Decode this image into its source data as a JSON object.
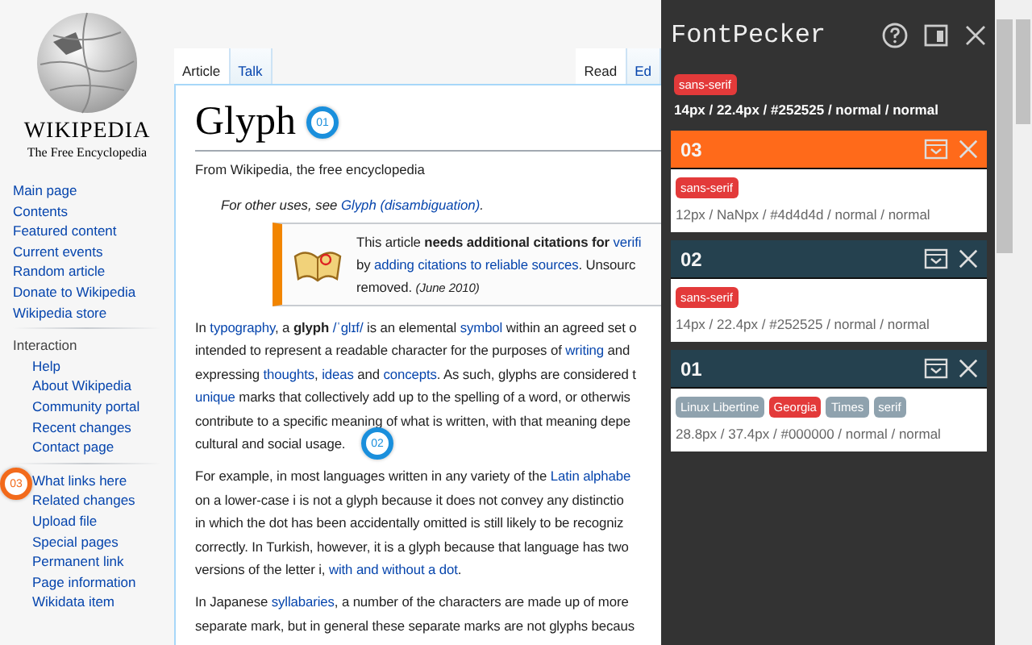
{
  "sidebar": {
    "logo": {
      "wordmark": "WIKIPEDIA",
      "tagline": "The Free Encyclopedia"
    },
    "navigation": [
      "Main page",
      "Contents",
      "Featured content",
      "Current events",
      "Random article",
      "Donate to Wikipedia",
      "Wikipedia store"
    ],
    "interaction": {
      "heading": "Interaction",
      "items": [
        "Help",
        "About Wikipedia",
        "Community portal",
        "Recent changes",
        "Contact page"
      ]
    },
    "tools": {
      "items": [
        "What links here",
        "Related changes",
        "Upload file",
        "Special pages",
        "Permanent link",
        "Page information",
        "Wikidata item"
      ]
    }
  },
  "tabs": {
    "left": [
      {
        "label": "Article",
        "selected": true
      },
      {
        "label": "Talk",
        "selected": false
      }
    ],
    "right": [
      {
        "label": "Read",
        "selected": true
      },
      {
        "label": "Ed",
        "selected": false
      }
    ]
  },
  "article": {
    "title": "Glyph",
    "subtitle": "From Wikipedia, the free encyclopedia",
    "hatnote": [
      {
        "kind": "text",
        "text": "For other uses, see "
      },
      {
        "kind": "link",
        "text": "Glyph (disambiguation)"
      },
      {
        "kind": "text",
        "text": "."
      }
    ],
    "notice": [
      [
        {
          "kind": "text",
          "text": "This article "
        },
        {
          "kind": "bold",
          "text": "needs additional citations for "
        },
        {
          "kind": "link",
          "text": "verifi"
        }
      ],
      [
        {
          "kind": "text",
          "text": "by "
        },
        {
          "kind": "link",
          "text": "adding citations to reliable sources"
        },
        {
          "kind": "text",
          "text": ". Unsourc"
        }
      ],
      [
        {
          "kind": "text",
          "text": "removed. "
        },
        {
          "kind": "italic",
          "text": "(June 2010)"
        }
      ]
    ],
    "paragraphs": [
      [
        [
          {
            "kind": "text",
            "text": "In "
          },
          {
            "kind": "link",
            "text": "typography"
          },
          {
            "kind": "text",
            "text": ", a "
          },
          {
            "kind": "bold",
            "text": "glyph "
          },
          {
            "kind": "link",
            "text": "/ˈɡlɪf/"
          },
          {
            "kind": "text",
            "text": " is an elemental "
          },
          {
            "kind": "link",
            "text": "symbol"
          },
          {
            "kind": "text",
            "text": " within an agreed set o"
          }
        ],
        [
          {
            "kind": "text",
            "text": "intended to represent a readable character for the purposes of "
          },
          {
            "kind": "link",
            "text": "writing"
          },
          {
            "kind": "text",
            "text": " and"
          }
        ],
        [
          {
            "kind": "text",
            "text": "expressing "
          },
          {
            "kind": "link",
            "text": "thoughts"
          },
          {
            "kind": "text",
            "text": ", "
          },
          {
            "kind": "link",
            "text": "ideas"
          },
          {
            "kind": "text",
            "text": " and "
          },
          {
            "kind": "link",
            "text": "concepts"
          },
          {
            "kind": "text",
            "text": ". As such, glyphs are considered t"
          }
        ],
        [
          {
            "kind": "link",
            "text": "unique"
          },
          {
            "kind": "text",
            "text": " marks that collectively add up to the spelling of a word, or otherwis"
          }
        ],
        [
          {
            "kind": "text",
            "text": "contribute to a specific meaning of what is written, with that meaning depe"
          }
        ],
        [
          {
            "kind": "text",
            "text": "cultural and social usage."
          }
        ]
      ],
      [
        [
          {
            "kind": "text",
            "text": "For example, in most languages written in any variety of the "
          },
          {
            "kind": "link",
            "text": "Latin alphabe"
          }
        ],
        [
          {
            "kind": "text",
            "text": "on a lower-case i is not a glyph because it does not convey any distinctio"
          }
        ],
        [
          {
            "kind": "text",
            "text": "in which the dot has been accidentally omitted is still likely to be recogniz"
          }
        ],
        [
          {
            "kind": "text",
            "text": "correctly. In Turkish, however, it is a glyph because that language has two"
          }
        ],
        [
          {
            "kind": "text",
            "text": "versions of the letter i, "
          },
          {
            "kind": "link",
            "text": "with and without a dot"
          },
          {
            "kind": "text",
            "text": "."
          }
        ]
      ],
      [
        [
          {
            "kind": "text",
            "text": "In Japanese "
          },
          {
            "kind": "link",
            "text": "syllabaries"
          },
          {
            "kind": "text",
            "text": ", a number of the characters are made up of more"
          }
        ],
        [
          {
            "kind": "text",
            "text": "separate mark, but in general these separate marks are not glyphs becaus"
          }
        ]
      ]
    ]
  },
  "markers": [
    {
      "label": "01",
      "color": "#1a8fdc"
    },
    {
      "label": "02",
      "color": "#1a8fdc"
    },
    {
      "label": "03",
      "color": "#f26a1b"
    }
  ],
  "panel": {
    "title": "FontPecker",
    "current": {
      "fonts": [
        {
          "name": "sans-serif",
          "used": true
        }
      ],
      "details": "14px / 22.4px / #252525 / normal / normal"
    },
    "cards": [
      {
        "number": "03",
        "color": "#ff6a1a",
        "fonts": [
          {
            "name": "sans-serif",
            "used": true
          }
        ],
        "details": "12px / NaNpx / #4d4d4d / normal / normal"
      },
      {
        "number": "02",
        "color": "#25414f",
        "fonts": [
          {
            "name": "sans-serif",
            "used": true
          }
        ],
        "details": "14px / 22.4px / #252525 / normal / normal"
      },
      {
        "number": "01",
        "color": "#25414f",
        "fonts": [
          {
            "name": "Linux Libertine",
            "used": false
          },
          {
            "name": "Georgia",
            "used": true
          },
          {
            "name": "Times",
            "used": false
          },
          {
            "name": "serif",
            "used": false
          }
        ],
        "details": "28.8px / 37.4px / #000000 / normal / normal"
      }
    ]
  }
}
